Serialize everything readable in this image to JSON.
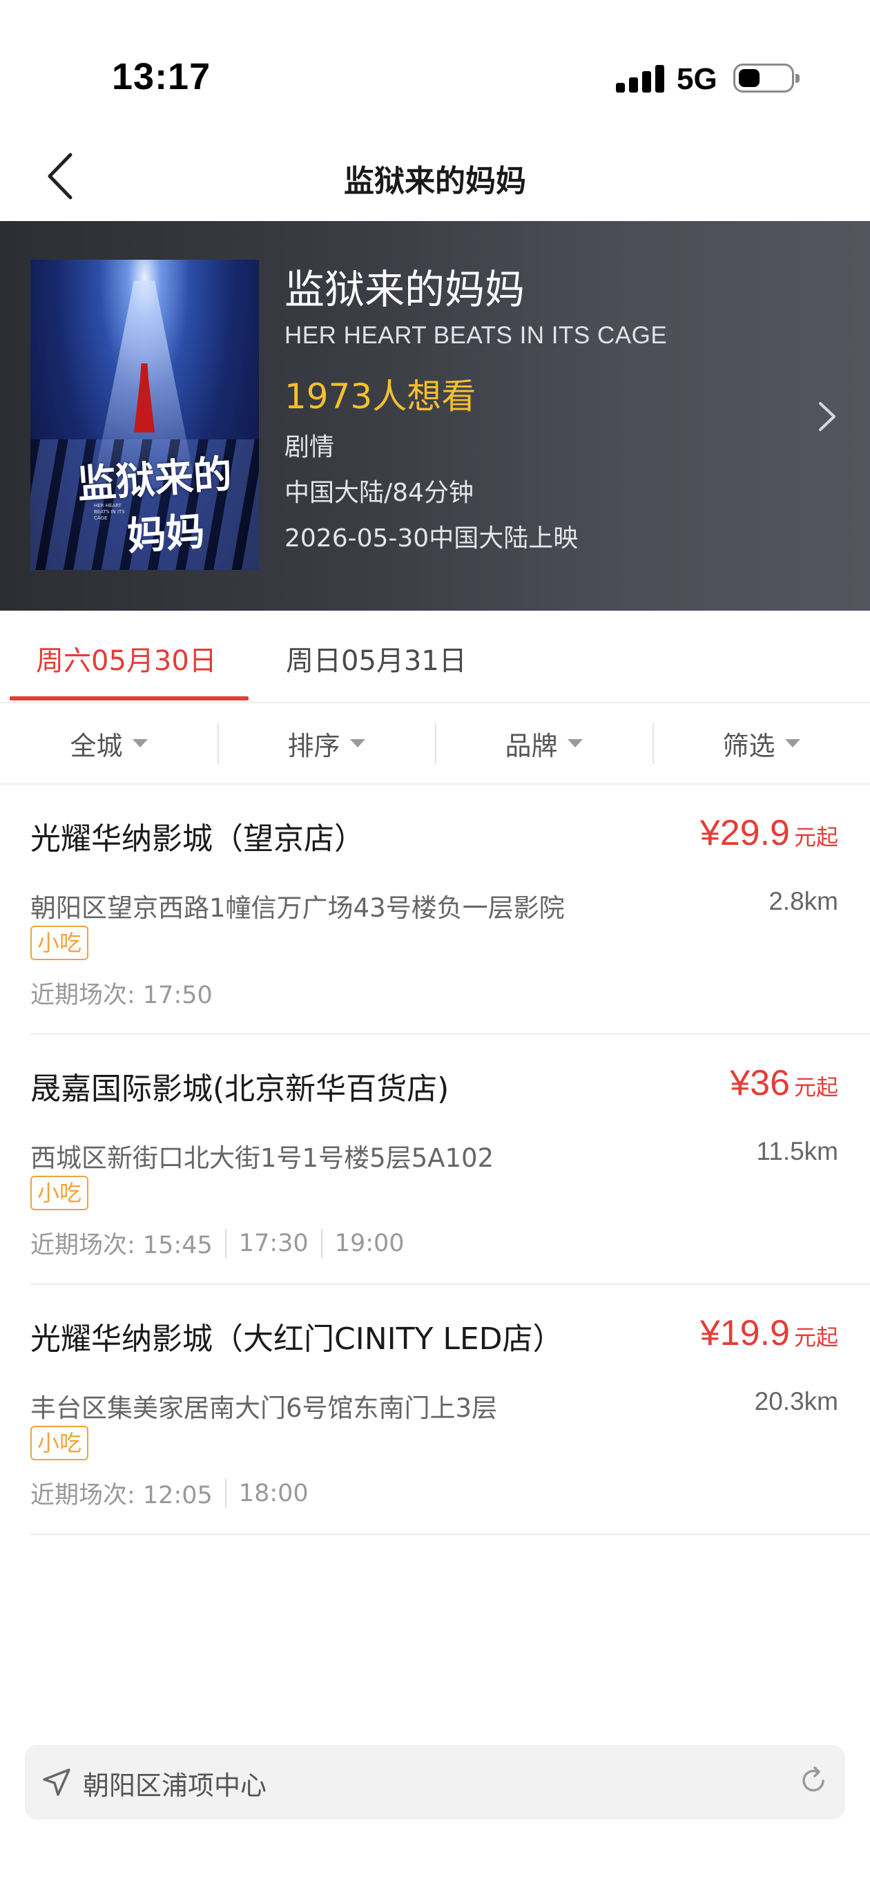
{
  "status_bar": {
    "time": "13:17",
    "network": "5G"
  },
  "nav": {
    "title": "监狱来的妈妈"
  },
  "movie": {
    "title": "监狱来的妈妈",
    "english_title": "HER HEART BEATS IN ITS CAGE",
    "want_to_see": "1973人想看",
    "genre": "剧情",
    "meta": "中国大陆/84分钟",
    "release": "2026-05-30中国大陆上映",
    "poster_calligraphy_line1": "监狱来的",
    "poster_calligraphy_line2": "妈妈",
    "poster_small_text": "HER HEART BEATS IN ITS CAGE"
  },
  "date_tabs": [
    {
      "label": "周六05月30日",
      "active": true
    },
    {
      "label": "周日05月31日",
      "active": false
    }
  ],
  "filters": [
    "全城",
    "排序",
    "品牌",
    "筛选"
  ],
  "cinemas": [
    {
      "name": "光耀华纳影城（望京店）",
      "price": "¥29.9",
      "price_unit": "元起",
      "address": "朝阳区望京西路1幢信万广场43号楼负一层影院",
      "distance": "2.8km",
      "tag": "小吃",
      "times_label": "近期场次: 17:50",
      "extra_times": []
    },
    {
      "name": "晟嘉国际影城(北京新华百货店)",
      "price": "¥36",
      "price_unit": "元起",
      "address": "西城区新街口北大街1号1号楼5层5A102",
      "distance": "11.5km",
      "tag": "小吃",
      "times_label": "近期场次: 15:45",
      "extra_times": [
        "17:30",
        "19:00"
      ]
    },
    {
      "name": "光耀华纳影城（大红门CINITY LED店）",
      "price": "¥19.9",
      "price_unit": "元起",
      "address": "丰台区集美家居南大门6号馆东南门上3层",
      "distance": "20.3km",
      "tag": "小吃",
      "times_label": "近期场次: 12:05",
      "extra_times": [
        "18:00"
      ]
    }
  ],
  "location": {
    "text": "朝阳区浦项中心"
  },
  "colors": {
    "accent": "#e53c37",
    "want": "#f5bf2e",
    "tag": "#f0a33c"
  }
}
